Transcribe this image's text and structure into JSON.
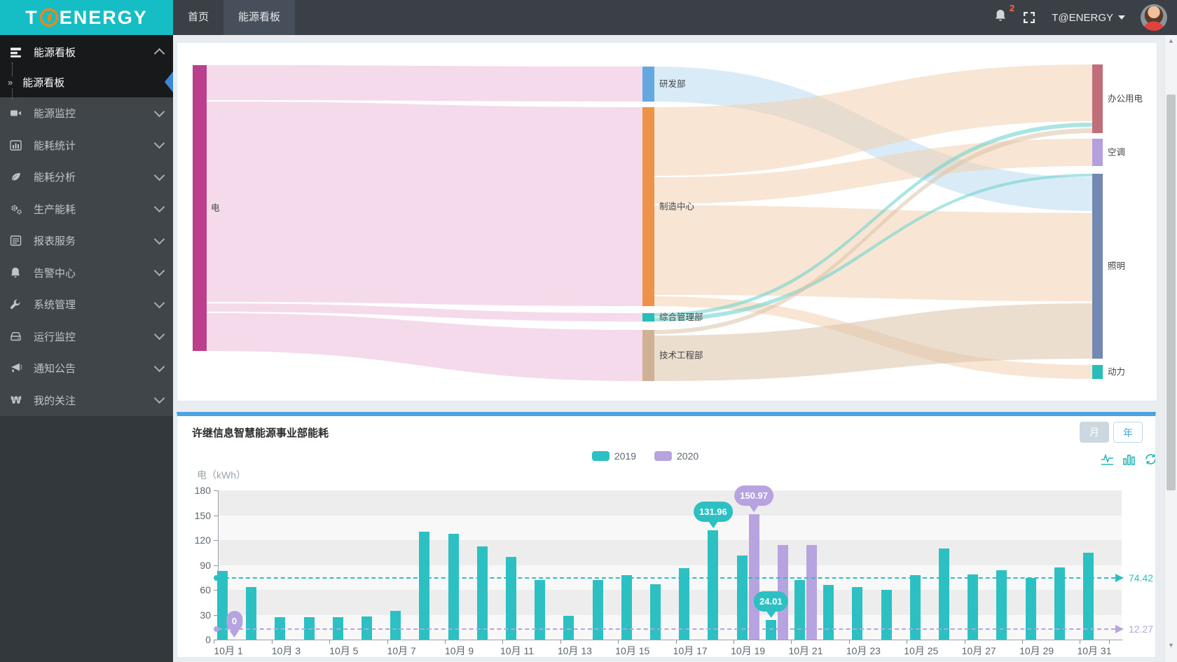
{
  "header": {
    "logo_prefix": "T",
    "logo_suffix": "ENERGY",
    "tabs": [
      {
        "label": "首页",
        "active": false
      },
      {
        "label": "能源看板",
        "active": true
      }
    ],
    "notification_count": "2",
    "user_name": "T@ENERGY"
  },
  "sidebar": {
    "group": {
      "label": "能源看板",
      "icon": "dashboard-icon",
      "expanded": true
    },
    "submenu": {
      "label": "能源看板",
      "active": true
    },
    "items": [
      {
        "label": "能源监控",
        "icon": "camera-icon"
      },
      {
        "label": "能耗统计",
        "icon": "stats-icon"
      },
      {
        "label": "能耗分析",
        "icon": "leaf-icon"
      },
      {
        "label": "生产能耗",
        "icon": "gears-icon"
      },
      {
        "label": "报表服务",
        "icon": "report-icon"
      },
      {
        "label": "告警中心",
        "icon": "bell-icon"
      },
      {
        "label": "系统管理",
        "icon": "wrench-icon"
      },
      {
        "label": "运行监控",
        "icon": "drive-icon"
      },
      {
        "label": "通知公告",
        "icon": "megaphone-icon"
      },
      {
        "label": "我的关注",
        "icon": "won-icon"
      }
    ]
  },
  "energy_panel": {
    "title": "许继信息智慧能源事业部能耗",
    "unit_label": "电（kWh）",
    "toggle_month": "月",
    "toggle_year": "年",
    "active_toggle": "月",
    "toolbox_icons": [
      "line-chart-icon",
      "bar-chart-icon",
      "refresh-icon"
    ]
  },
  "colors": {
    "brand_teal": "#14bec4",
    "accent_blue": "#4aa4e0",
    "series_2019": "#2cc0c2",
    "series_2020": "#b7a3e0",
    "badge_orange": "#ff6a3a"
  },
  "chart_data": [
    {
      "type": "sankey",
      "title": "",
      "nodes": [
        {
          "id": "dian",
          "label": "电",
          "color": "#bc3f8c"
        },
        {
          "id": "yanfa",
          "label": "研发部",
          "color": "#65a8e0"
        },
        {
          "id": "zhizao",
          "label": "制造中心",
          "color": "#ea9349"
        },
        {
          "id": "zonghe",
          "label": "综合管理部",
          "color": "#28bdb6"
        },
        {
          "id": "jishu",
          "label": "技术工程部",
          "color": "#cfb193"
        },
        {
          "id": "bangong",
          "label": "办公用电",
          "color": "#c16e7b"
        },
        {
          "id": "kongtiao",
          "label": "空调",
          "color": "#b4a0dd"
        },
        {
          "id": "zhaoming",
          "label": "照明",
          "color": "#7389b2"
        },
        {
          "id": "dongli",
          "label": "动力",
          "color": "#28bdb6"
        }
      ],
      "links": [
        {
          "source": "电",
          "target": "研发部"
        },
        {
          "source": "电",
          "target": "制造中心"
        },
        {
          "source": "电",
          "target": "综合管理部"
        },
        {
          "source": "电",
          "target": "技术工程部"
        },
        {
          "source": "研发部",
          "target": "照明"
        },
        {
          "source": "制造中心",
          "target": "办公用电"
        },
        {
          "source": "制造中心",
          "target": "空调"
        },
        {
          "source": "制造中心",
          "target": "照明"
        },
        {
          "source": "制造中心",
          "target": "动力"
        },
        {
          "source": "综合管理部",
          "target": "办公用电"
        },
        {
          "source": "综合管理部",
          "target": "照明"
        },
        {
          "source": "技术工程部",
          "target": "办公用电"
        },
        {
          "source": "技术工程部",
          "target": "照明"
        }
      ]
    },
    {
      "type": "bar",
      "title": "许继信息智慧能源事业部能耗",
      "ylabel": "电（kWh）",
      "ylim": [
        0,
        180
      ],
      "ytick_interval": 30,
      "yticks": [
        0,
        30,
        60,
        90,
        120,
        150,
        180
      ],
      "x_labels_shown": "odd days only",
      "categories": [
        "10月 1",
        "10月 2",
        "10月 3",
        "10月 4",
        "10月 5",
        "10月 6",
        "10月 7",
        "10月 8",
        "10月 9",
        "10月 10",
        "10月 11",
        "10月 12",
        "10月 13",
        "10月 14",
        "10月 15",
        "10月 16",
        "10月 17",
        "10月 18",
        "10月 19",
        "10月 20",
        "10月 21",
        "10月 22",
        "10月 23",
        "10月 24",
        "10月 25",
        "10月 26",
        "10月 27",
        "10月 28",
        "10月 29",
        "10月 30",
        "10月 31"
      ],
      "series": [
        {
          "name": "2019",
          "color": "#2cc0c2",
          "values": [
            83,
            63,
            27,
            27,
            27,
            28,
            35,
            130,
            128,
            112,
            100,
            72,
            29,
            72,
            78,
            67,
            86,
            131.96,
            101,
            24.01,
            72,
            66,
            63,
            60,
            78,
            110,
            79,
            84,
            74,
            87,
            105
          ]
        },
        {
          "name": "2020",
          "color": "#b7a3e0",
          "values": [
            0,
            null,
            null,
            null,
            null,
            null,
            null,
            null,
            null,
            null,
            null,
            null,
            null,
            null,
            null,
            null,
            null,
            null,
            150.97,
            114,
            114,
            null,
            null,
            null,
            null,
            null,
            null,
            null,
            null,
            null,
            null
          ]
        }
      ],
      "averages": [
        {
          "series": "2019",
          "value": 74.42,
          "label": "74.42"
        },
        {
          "series": "2020",
          "value": 12.27,
          "label": "12.27"
        }
      ],
      "markers": [
        {
          "series": "2020",
          "category": "10月 1",
          "value": 0,
          "label": "0"
        },
        {
          "series": "2019",
          "category": "10月 18",
          "value": 131.96,
          "label": "131.96"
        },
        {
          "series": "2020",
          "category": "10月 19",
          "value": 150.97,
          "label": "150.97"
        },
        {
          "series": "2019",
          "category": "10月 20",
          "value": 24.01,
          "label": "24.01"
        }
      ],
      "legend": [
        "2019",
        "2020"
      ],
      "legend_position": "top-center",
      "grid_bands": true
    }
  ]
}
